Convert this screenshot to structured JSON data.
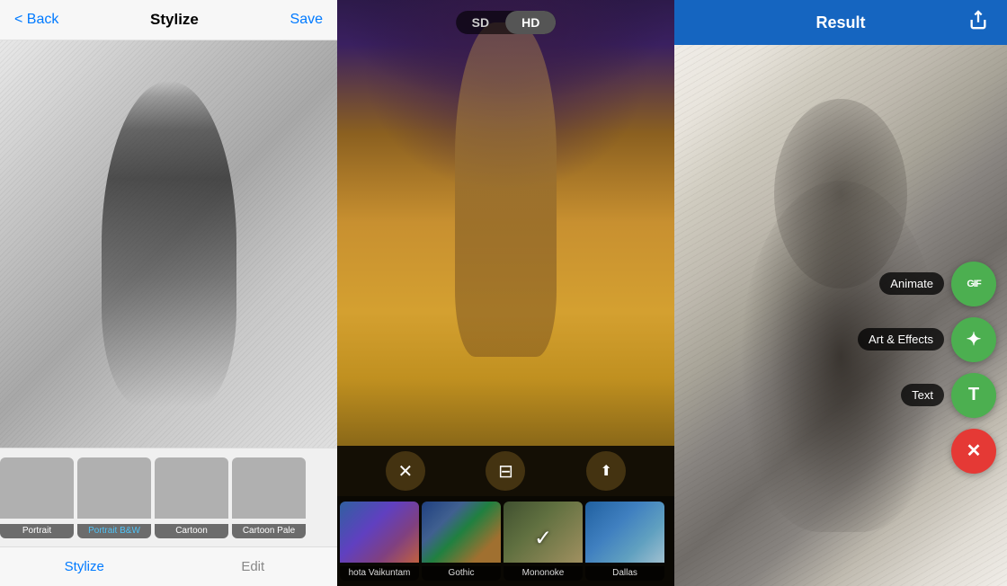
{
  "panel1": {
    "back_label": "< Back",
    "title": "Stylize",
    "save_label": "Save",
    "filters": [
      {
        "id": "portrait",
        "label": "Portrait",
        "active": false,
        "face_class": "face-portrait"
      },
      {
        "id": "portrait-bw",
        "label": "Portrait B&W",
        "active": true,
        "face_class": "face-bw"
      },
      {
        "id": "cartoon",
        "label": "Cartoon",
        "active": false,
        "face_class": "face-cartoon"
      },
      {
        "id": "cartoon-pale",
        "label": "Cartoon Pale",
        "active": false,
        "face_class": "face-pale"
      }
    ],
    "bottom_tabs": [
      {
        "id": "stylize",
        "label": "Stylize",
        "active": true
      },
      {
        "id": "edit",
        "label": "Edit",
        "active": false
      }
    ]
  },
  "panel2": {
    "quality_options": [
      {
        "id": "sd",
        "label": "SD",
        "active": false
      },
      {
        "id": "hd",
        "label": "HD",
        "active": true
      }
    ],
    "action_icons": [
      {
        "id": "close",
        "symbol": "✕"
      },
      {
        "id": "sliders",
        "symbol": "⊟"
      },
      {
        "id": "share",
        "symbol": "⬆"
      }
    ],
    "art_filters": [
      {
        "id": "vaikuntam",
        "label": "hota Vaikuntam",
        "active": false,
        "bg_class": "af-vaikuntam"
      },
      {
        "id": "gothic",
        "label": "Gothic",
        "active": false,
        "bg_class": "af-gothic"
      },
      {
        "id": "mononoke",
        "label": "Mononoke",
        "active": true,
        "bg_class": "af-mononoke"
      },
      {
        "id": "dallas",
        "label": "Dallas",
        "active": false,
        "bg_class": "af-dallas"
      }
    ]
  },
  "panel3": {
    "title": "Result",
    "share_icon": "⬆",
    "fab_items": [
      {
        "id": "animate",
        "label": "Animate",
        "icon": "GIF",
        "is_close": false
      },
      {
        "id": "art-effects",
        "label": "Art & Effects",
        "icon": "✦",
        "is_close": false
      },
      {
        "id": "text",
        "label": "Text",
        "icon": "T",
        "is_close": false
      },
      {
        "id": "close",
        "label": "",
        "icon": "✕",
        "is_close": true
      }
    ]
  }
}
